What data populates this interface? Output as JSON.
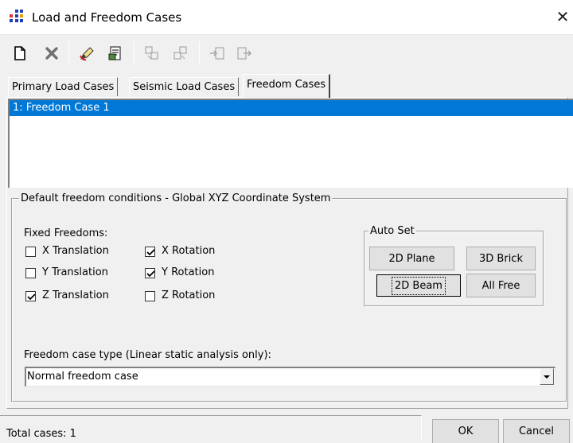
{
  "window": {
    "title": "Load and Freedom Cases",
    "close_symbol": "✕"
  },
  "toolbar": {
    "buttons": [
      "new-icon",
      "delete-icon",
      "edit-pen-icon",
      "properties-icon",
      "copy-icon",
      "paste-icon",
      "import-icon",
      "export-icon"
    ]
  },
  "tabs": [
    {
      "label": "Primary Load Cases"
    },
    {
      "label": "Seismic Load Cases"
    },
    {
      "label": "Freedom Cases"
    }
  ],
  "case_list": {
    "items": [
      "1: Freedom Case 1"
    ]
  },
  "defaults_group": {
    "title": "Default freedom conditions - Global XYZ Coordinate System",
    "fixed_label": "Fixed Freedoms:",
    "checkboxes": [
      {
        "label": "X Translation",
        "checked": false
      },
      {
        "label": "Y Translation",
        "checked": false
      },
      {
        "label": "Z Translation",
        "checked": true
      },
      {
        "label": "X Rotation",
        "checked": true
      },
      {
        "label": "Y Rotation",
        "checked": true
      },
      {
        "label": "Z Rotation",
        "checked": false
      }
    ],
    "auto_set": {
      "title": "Auto Set",
      "buttons": {
        "plane": "2D Plane",
        "brick": "3D Brick",
        "beam": "2D Beam",
        "free": "All Free"
      }
    },
    "type_label": "Freedom case type (Linear static analysis only):",
    "type_value": "Normal freedom case"
  },
  "status": {
    "text": "Total cases: 1"
  },
  "footer": {
    "ok": "OK",
    "cancel": "Cancel"
  },
  "colors": {
    "selection": "#0078d7",
    "background": "#f0f0f0"
  }
}
